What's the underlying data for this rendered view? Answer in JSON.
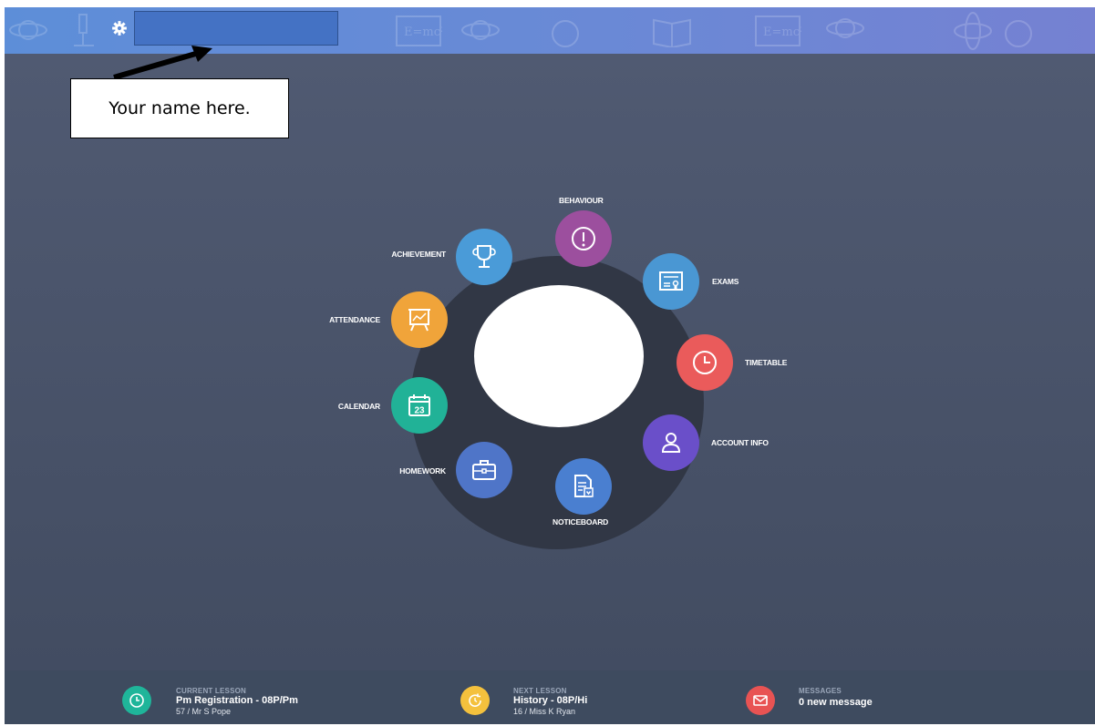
{
  "header": {
    "name_placeholder": "",
    "settings_icon": "gear-icon"
  },
  "callout": {
    "text": "Your name here."
  },
  "menu": {
    "items": [
      {
        "key": "behaviour",
        "label": "BEHAVIOUR",
        "color": "#9c4f9e",
        "icon": "exclamation-circle-icon"
      },
      {
        "key": "exams",
        "label": "EXAMS",
        "color": "#4a97d3",
        "icon": "certificate-icon"
      },
      {
        "key": "timetable",
        "label": "TIMETABLE",
        "color": "#ea5b5b",
        "icon": "clock-icon"
      },
      {
        "key": "account_info",
        "label": "ACCOUNT INFO",
        "color": "#6a4fc9",
        "icon": "user-icon"
      },
      {
        "key": "noticeboard",
        "label": "NOTICEBOARD",
        "color": "#4a7fd0",
        "icon": "document-download-icon"
      },
      {
        "key": "homework",
        "label": "HOMEWORK",
        "color": "#4f75c8",
        "icon": "briefcase-icon"
      },
      {
        "key": "calendar",
        "label": "CALENDAR",
        "color": "#21b297",
        "icon": "calendar-icon",
        "day": "23"
      },
      {
        "key": "attendance",
        "label": "ATTENDANCE",
        "color": "#f0a43a",
        "icon": "presentation-chart-icon"
      },
      {
        "key": "achievement",
        "label": "ACHIEVEMENT",
        "color": "#4a9bd8",
        "icon": "trophy-icon"
      }
    ]
  },
  "footer": {
    "current": {
      "caption": "CURRENT LESSON",
      "title": "Pm Registration - 08P/Pm",
      "sub": "57 / Mr S Pope",
      "color": "#1fb59a"
    },
    "next": {
      "caption": "NEXT LESSON",
      "title": "History - 08P/Hi",
      "sub": "16 / Miss K Ryan",
      "color": "#f4c13d"
    },
    "messages": {
      "caption": "MESSAGES",
      "title": "0 new message",
      "color": "#e85353"
    }
  }
}
